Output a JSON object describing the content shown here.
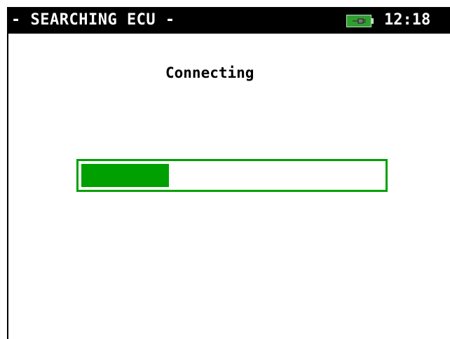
{
  "header": {
    "title": "- SEARCHING ECU -",
    "clock": "12:18",
    "battery_icon": "battery-charging-icon"
  },
  "main": {
    "status_text": "Connecting",
    "progress": {
      "fraction": 0.29
    }
  },
  "colors": {
    "header_bg": "#000000",
    "header_text": "#ffffff",
    "accent": "#00a000",
    "battery_body": "#2fa02f",
    "background": "#ffffff"
  }
}
